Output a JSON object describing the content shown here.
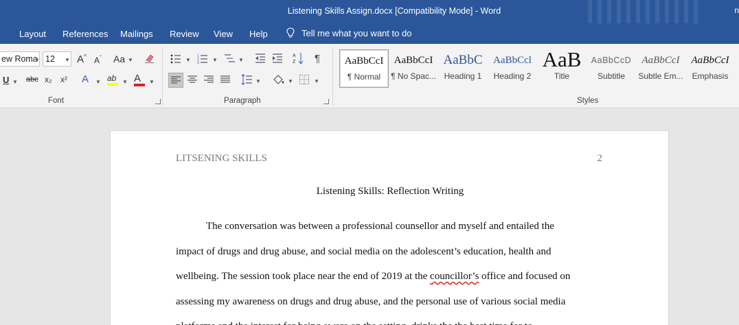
{
  "window": {
    "title": "Listening Skills Assign.docx [Compatibility Mode]  -  Word",
    "user_initial": "n"
  },
  "menu": {
    "tabs": [
      "Layout",
      "References",
      "Mailings",
      "Review",
      "View",
      "Help"
    ],
    "tell_me": "Tell me what you want to do"
  },
  "ribbon": {
    "font": {
      "name": "ew Roma",
      "size": "12",
      "group_label": "Font",
      "underline": "U",
      "strike": "abc",
      "subscript": "x₂",
      "superscript": "x²",
      "grow": "A",
      "shrink": "A",
      "case": "Aa",
      "effects": "A",
      "highlight": "ab",
      "font_color": "A",
      "highlight_color": "#ffff00",
      "font_color_bar": "#e02020"
    },
    "paragraph": {
      "group_label": "Paragraph"
    },
    "styles": {
      "group_label": "Styles",
      "items": [
        {
          "preview": "AaBbCcI",
          "label": "¶ Normal"
        },
        {
          "preview": "AaBbCcI",
          "label": "¶ No Spac..."
        },
        {
          "preview": "AaBbC",
          "label": "Heading 1"
        },
        {
          "preview": "AaBbCcl",
          "label": "Heading 2"
        },
        {
          "preview": "AaB",
          "label": "Title"
        },
        {
          "preview": "AaBbCcD",
          "label": "Subtitle"
        },
        {
          "preview": "AaBbCcI",
          "label": "Subtle Em..."
        },
        {
          "preview": "AaBbCcI",
          "label": "Emphasis"
        }
      ]
    }
  },
  "document": {
    "running_head": "LITSENING SKILLS",
    "page_number": "2",
    "title": "Listening Skills: Reflection Writing",
    "lines": [
      "The conversation was between a professional counsellor and myself and entailed the",
      "impact of drugs and drug abuse, and social media on the adolescent’s education, health and",
      "wellbeing. The session took place near the end of 2019 at the ",
      "assessing my awareness on drugs and drug abuse, and the personal use of various social media",
      "platforms and the interest for being aware on the setting, drinks the the best time for to"
    ],
    "misspelled": "councillor’s",
    "line3_tail": " office and focused on"
  },
  "colors": {
    "title_bar": "#2b579a",
    "ribbon": "#f3f3f3",
    "workspace": "#e6e6e6",
    "heading_blue": "#2f5496"
  }
}
